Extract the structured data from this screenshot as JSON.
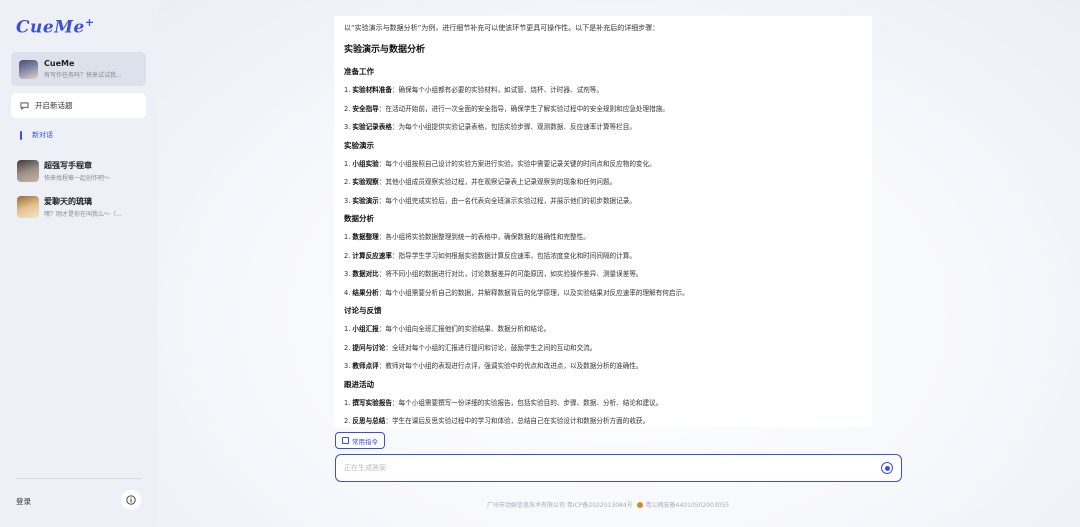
{
  "sidebar": {
    "logo": "CueMe",
    "logo_plus": "+",
    "bot": {
      "name": "CueMe",
      "subtitle": "有写作任务吗？快来试试我..."
    },
    "new_topic_label": "开启新话题",
    "new_chat_label": "新对话",
    "conversations": [
      {
        "name": "超强写手程章",
        "subtitle": "快来找程章一起创作吧～"
      },
      {
        "name": "爱聊天的琉璃",
        "subtitle": "嘿？刚才是你在叫我么～（..."
      }
    ],
    "login_label": "登录"
  },
  "content": {
    "intro": "以“实验演示与数据分析”为例，进行细节补充可以使该环节更具可操作性。以下是补充后的详细步骤：",
    "title": "实验演示与数据分析",
    "sections": [
      {
        "heading": "准备工作",
        "items": [
          {
            "num": "1.",
            "bold": "实验材料准备",
            "text": "：确保每个小组都有必要的实验材料，如试管、烧杯、计时器、试剂等。"
          },
          {
            "num": "2.",
            "bold": "安全指导",
            "text": "：在活动开始前，进行一次全面的安全指导，确保学生了解实验过程中的安全规则和应急处理措施。"
          },
          {
            "num": "3.",
            "bold": "实验记录表格",
            "text": "：为每个小组提供实验记录表格，包括实验步骤、观测数据、反应速率计算等栏目。"
          }
        ]
      },
      {
        "heading": "实验演示",
        "items": [
          {
            "num": "1.",
            "bold": "小组实验",
            "text": "：每个小组按照自己设计的实验方案进行实验。实验中需要记录关键的时间点和反应物的变化。"
          },
          {
            "num": "2.",
            "bold": "实验观察",
            "text": "：其他小组成员观察实验过程，并在观察记录表上记录观察到的现象和任何问题。"
          },
          {
            "num": "3.",
            "bold": "实验演示",
            "text": "：每个小组完成实验后，由一名代表向全班演示实验过程，并展示他们的初步数据记录。"
          }
        ]
      },
      {
        "heading": "数据分析",
        "items": [
          {
            "num": "1.",
            "bold": "数据整理",
            "text": "：各小组将实验数据整理到统一的表格中，确保数据的准确性和完整性。"
          },
          {
            "num": "2.",
            "bold": "计算反应速率",
            "text": "：指导学生学习如何根据实验数据计算反应速率，包括浓度变化和时间间隔的计算。"
          },
          {
            "num": "3.",
            "bold": "数据对比",
            "text": "：将不同小组的数据进行对比，讨论数据差异的可能原因，如实验操作差异、测量误差等。"
          },
          {
            "num": "4.",
            "bold": "结果分析",
            "text": "：每个小组需要分析自己的数据，并解释数据背后的化学原理，以及实验结果对反应速率的理解有何启示。"
          }
        ]
      },
      {
        "heading": "讨论与反馈",
        "items": [
          {
            "num": "1.",
            "bold": "小组汇报",
            "text": "：每个小组向全班汇报他们的实验结果、数据分析和结论。"
          },
          {
            "num": "2.",
            "bold": "提问与讨论",
            "text": "：全班对每个小组的汇报进行提问和讨论，鼓励学生之间的互动和交流。"
          },
          {
            "num": "3.",
            "bold": "教师点评",
            "text": "：教师对每个小组的表现进行点评，强调实验中的优点和改进点，以及数据分析的准确性。"
          }
        ]
      },
      {
        "heading": "跟进活动",
        "items": [
          {
            "num": "1.",
            "bold": "撰写实验报告",
            "text": "：每个小组需要撰写一份详细的实验报告，包括实验目的、步骤、数据、分析、结论和建议。"
          },
          {
            "num": "2.",
            "bold": "反思与总结",
            "text": "：学生在课后反思实验过程中的学习和体验，总结自己在实验设计和数据分析方面的收获。"
          }
        ]
      }
    ]
  },
  "composer": {
    "command_button": "常用指令",
    "input_placeholder": "正在生成答案"
  },
  "footer": {
    "icp": "广州市动娱信息技术有限公司 粤ICP备2022013084号",
    "police": "粤公网安备44010502003055"
  },
  "colors": {
    "accent": "#3b4fd8",
    "sidebar_bg": "#eef0f7"
  }
}
